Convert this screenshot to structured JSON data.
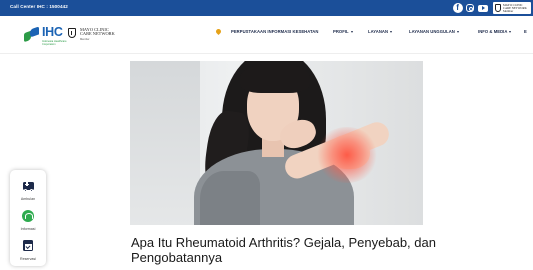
{
  "topbar": {
    "call_center": "Call Center IHC : 1500442",
    "social_icons": [
      "facebook-icon",
      "instagram-icon",
      "youtube-icon"
    ],
    "partner_badge_lines": [
      "MAYO CLINIC",
      "CARE NETWORK",
      "Member"
    ],
    "bg_color": "#1b4f99"
  },
  "header": {
    "logo_text": "IHC",
    "logo_tagline": [
      "Indonesia Healthcare",
      "Corporation"
    ],
    "partner_logo_lines": "MAYO CLINIC\nCARE NETWORK",
    "partner_logo_member": "Member",
    "nav": [
      {
        "label": "PERPUSTAKAAN INFORMASI KESEHATAN",
        "has_dropdown": false
      },
      {
        "label": "PROFIL",
        "has_dropdown": true
      },
      {
        "label": "LAYANAN",
        "has_dropdown": true
      },
      {
        "label": "LAYANAN UNGGULAN",
        "has_dropdown": true
      },
      {
        "label": "INFO & MEDIA",
        "has_dropdown": true
      },
      {
        "label": "E",
        "has_dropdown": false
      }
    ]
  },
  "article": {
    "title": "Apa Itu Rheumatoid Arthritis? Gejala, Penyebab, dan Pengobatannya",
    "image_alt": "woman-holding-painful-wrist"
  },
  "side_widget": {
    "items": [
      {
        "label": "Ambulan",
        "icon": "ambulance-icon"
      },
      {
        "label": "Informasi",
        "icon": "headset-icon"
      },
      {
        "label": "Reservasi",
        "icon": "calendar-icon"
      }
    ]
  },
  "colors": {
    "brand_blue": "#1b63b4",
    "brand_green": "#2c9b47",
    "nav_text": "#1d2a4a"
  }
}
